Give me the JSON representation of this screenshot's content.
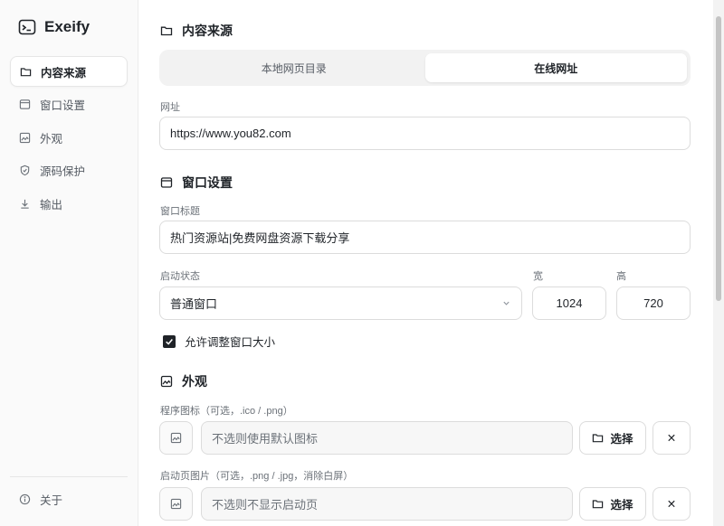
{
  "app": {
    "name": "Exeify"
  },
  "sidebar": {
    "items": [
      {
        "label": "内容来源",
        "icon": "folder-icon",
        "active": true
      },
      {
        "label": "窗口设置",
        "icon": "window-icon",
        "active": false
      },
      {
        "label": "外观",
        "icon": "image-icon",
        "active": false
      },
      {
        "label": "源码保护",
        "icon": "shield-icon",
        "active": false
      },
      {
        "label": "输出",
        "icon": "download-icon",
        "active": false
      }
    ],
    "about": "关于"
  },
  "content_source": {
    "title": "内容来源",
    "tabs": [
      {
        "label": "本地网页目录",
        "active": false
      },
      {
        "label": "在线网址",
        "active": true
      }
    ],
    "url_label": "网址",
    "url_value": "https://www.you82.com"
  },
  "window_settings": {
    "title": "窗口设置",
    "window_title_label": "窗口标题",
    "window_title_value": "热门资源站|免费网盘资源下载分享",
    "startup_state_label": "启动状态",
    "startup_state_value": "普通窗口",
    "width_label": "宽",
    "width_value": "1024",
    "height_label": "高",
    "height_value": "720",
    "resizable_label": "允许调整窗口大小",
    "resizable_checked": true
  },
  "appearance": {
    "title": "外观",
    "app_icon_label": "程序图标（可选，.ico / .png）",
    "app_icon_placeholder": "不选则使用默认图标",
    "splash_label": "启动页图片（可选，.png / .jpg，消除白屏）",
    "splash_placeholder": "不选则不显示启动页",
    "choose_label": "选择",
    "clear_symbol": "✕"
  }
}
